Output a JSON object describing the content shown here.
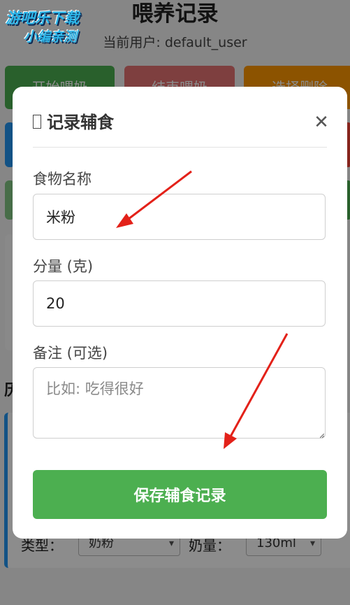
{
  "background": {
    "page_title": "喂养记录",
    "current_user": "当前用户: default_user",
    "buttons": {
      "start": "开始喂奶",
      "end": "结束喂奶",
      "delete": "选择删除"
    },
    "section_title": "历",
    "record": {
      "type_label": "类型：",
      "type_value": "奶粉",
      "amount_label": "奶量：",
      "amount_value": "130ml"
    }
  },
  "watermark": {
    "line1": "游吧乐下载",
    "line2": "小编亲测"
  },
  "modal": {
    "title": "记录辅食",
    "close_icon": "close-icon",
    "food_name": {
      "label": "食物名称",
      "value": "米粉"
    },
    "amount": {
      "label": "分量 (克)",
      "value": "20"
    },
    "note": {
      "label": "备注 (可选)",
      "placeholder": "比如: 吃得很好",
      "value": ""
    },
    "save_label": "保存辅食记录"
  },
  "colors": {
    "primary_green": "#4caf50",
    "danger_red": "#e57373",
    "warning_orange": "#ff9800",
    "info_blue": "#2196f3",
    "annotation_red": "#e32119"
  }
}
